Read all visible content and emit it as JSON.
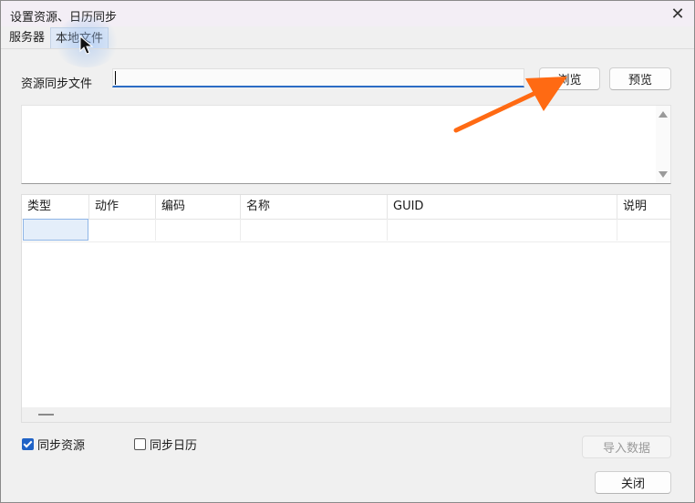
{
  "window": {
    "title": "设置资源、日历同步",
    "close_symbol": "✕"
  },
  "tabs": [
    {
      "label": "服务器",
      "active": false
    },
    {
      "label": "本地文件",
      "active": true
    }
  ],
  "sync_file": {
    "label": "资源同步文件",
    "value": "",
    "browse_label": "浏览",
    "preview_label": "预览"
  },
  "table": {
    "columns": [
      "类型",
      "动作",
      "编码",
      "名称",
      "GUID",
      "说明"
    ],
    "rows": [
      [
        "",
        "",
        "",
        "",
        "",
        ""
      ]
    ]
  },
  "options": {
    "sync_resources": {
      "label": "同步资源",
      "checked": true
    },
    "sync_calendar": {
      "label": "同步日历",
      "checked": false
    }
  },
  "buttons": {
    "import_label": "导入数据",
    "close_label": "关闭"
  },
  "colors": {
    "accent": "#1f62c6",
    "annotation_arrow": "#ff6a13"
  }
}
